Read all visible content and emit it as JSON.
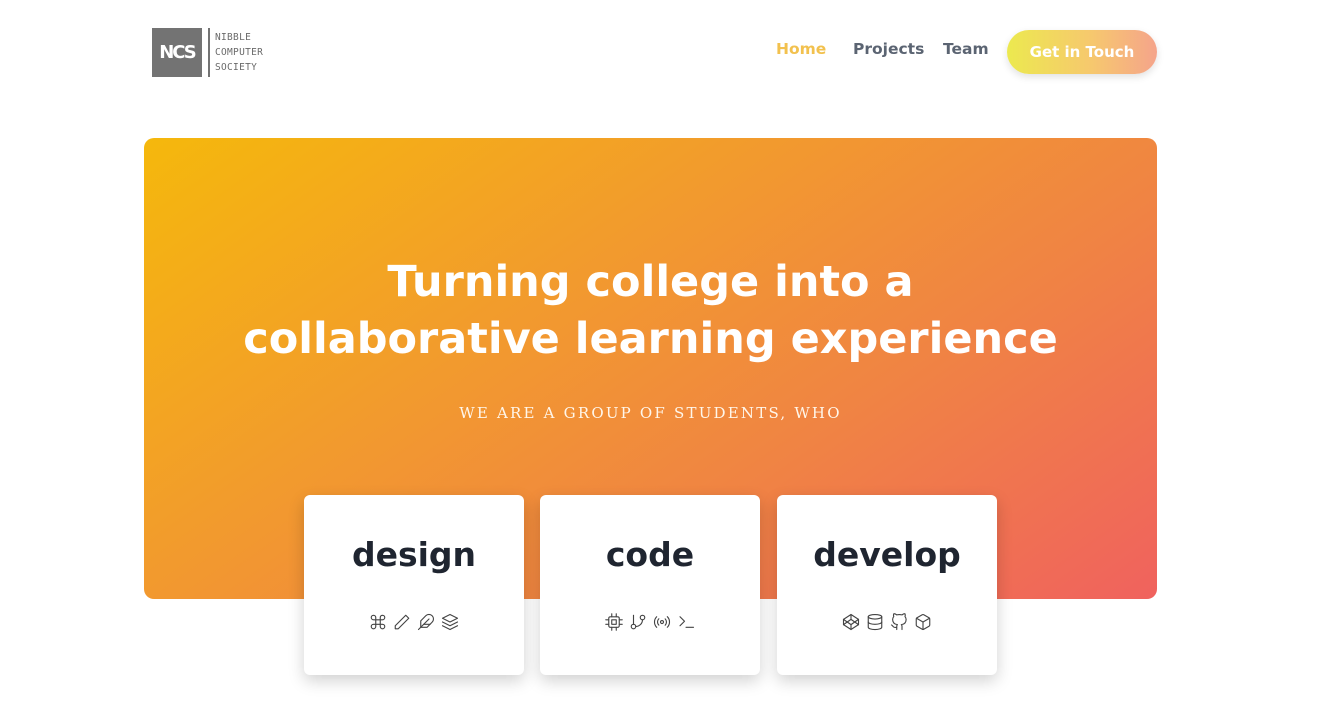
{
  "logo": {
    "mark": "NCS",
    "lines": [
      "NIBBLE",
      "COMPUTER",
      "SOCIETY"
    ]
  },
  "nav": {
    "home": "Home",
    "projects": "Projects",
    "team": "Team",
    "cta": "Get in Touch"
  },
  "hero": {
    "title_line1": "Turning college into a",
    "title_line2": "collaborative learning experience",
    "subtitle": "WE ARE A GROUP OF STUDENTS, WHO"
  },
  "cards": [
    {
      "title": "design",
      "icons": [
        "command-icon",
        "pencil-icon",
        "feather-icon",
        "layers-icon"
      ]
    },
    {
      "title": "code",
      "icons": [
        "cpu-icon",
        "git-branch-icon",
        "broadcast-icon",
        "terminal-icon"
      ]
    },
    {
      "title": "develop",
      "icons": [
        "codepen-icon",
        "database-icon",
        "github-icon",
        "package-icon"
      ]
    }
  ],
  "colors": {
    "accent": "#f2c14e",
    "nav_text": "#5b6472",
    "hero_start": "#f5b80c",
    "hero_end": "#f0625e",
    "logo_gray": "#737373"
  }
}
